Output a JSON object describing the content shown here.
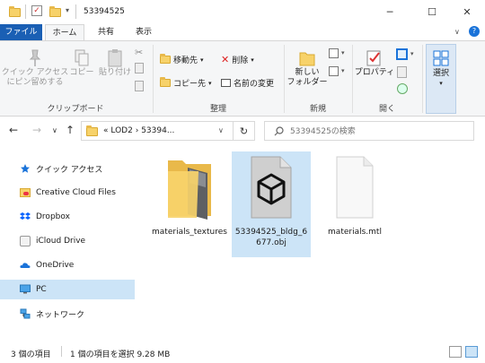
{
  "window": {
    "title": "53394525",
    "minimize": "─",
    "maximize": "☐",
    "close": "✕"
  },
  "tabs": [
    {
      "label": "ファイル"
    },
    {
      "label": "ホーム"
    },
    {
      "label": "共有"
    },
    {
      "label": "表示"
    }
  ],
  "ribbon": {
    "clipboard": {
      "label": "クリップボード",
      "pin_line1": "クイック アクセス",
      "pin_line2": "にピン留めする",
      "copy": "コピー",
      "paste": "貼り付け"
    },
    "organize": {
      "label": "整理",
      "move_to": "移動先",
      "copy_to": "コピー先",
      "delete": "削除",
      "rename": "名前の変更"
    },
    "new": {
      "label": "新規",
      "new_folder_line1": "新しい",
      "new_folder_line2": "フォルダー"
    },
    "open": {
      "label": "開く",
      "properties": "プロパティ"
    },
    "select": {
      "label": "選択"
    }
  },
  "address": {
    "chevrons": "«",
    "segment1": "LOD2",
    "separator": "›",
    "segment2": "53394..."
  },
  "search": {
    "placeholder": "53394525の検索"
  },
  "sidebar": {
    "items": [
      {
        "label": "クイック アクセス"
      },
      {
        "label": "Creative Cloud Files"
      },
      {
        "label": "Dropbox"
      },
      {
        "label": "iCloud Drive"
      },
      {
        "label": "OneDrive"
      },
      {
        "label": "PC"
      },
      {
        "label": "ネットワーク"
      }
    ]
  },
  "files": [
    {
      "name": "materials_textures",
      "type": "folder"
    },
    {
      "name": "53394525_bldg_6677.obj",
      "type": "obj"
    },
    {
      "name": "materials.mtl",
      "type": "file"
    }
  ],
  "status": {
    "item_count": "3 個の項目",
    "selection": "1 個の項目を選択  9.28 MB"
  },
  "colors": {
    "file_tab": "#1a5fb4",
    "selection": "#cce4f7",
    "folder": "#f7d26a"
  }
}
